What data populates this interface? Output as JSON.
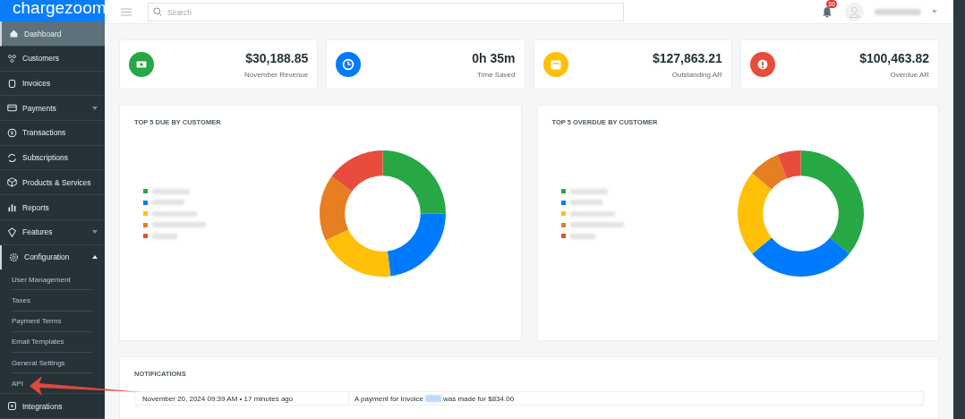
{
  "brand": "chargezoom",
  "sidebar": {
    "items": [
      {
        "label": "Dashboard",
        "selected": true
      },
      {
        "label": "Customers",
        "selected": false
      },
      {
        "label": "Invoices",
        "selected": false
      },
      {
        "label": "Payments",
        "selected": false,
        "expanded": false
      },
      {
        "label": "Transactions",
        "selected": false
      },
      {
        "label": "Subscriptions",
        "selected": false
      },
      {
        "label": "Products & Services",
        "selected": false
      },
      {
        "label": "Reports",
        "selected": false
      },
      {
        "label": "Features",
        "selected": false,
        "expanded": false
      },
      {
        "label": "Configuration",
        "selected": false,
        "expanded": true,
        "children": [
          {
            "label": "User Management",
            "selected": false
          },
          {
            "label": "Taxes",
            "selected": false
          },
          {
            "label": "Payment Terms",
            "selected": false
          },
          {
            "label": "Email Templates",
            "selected": false
          },
          {
            "label": "General Settings",
            "selected": false
          },
          {
            "label": "API",
            "selected": false
          }
        ]
      },
      {
        "label": "Integrations",
        "selected": false
      }
    ]
  },
  "topbar": {
    "search": {
      "placeholder": "Search"
    },
    "notification_badge": "36"
  },
  "stats": [
    {
      "value": "$30,188.85",
      "label": "November Revenue",
      "color": "#28a745"
    },
    {
      "value": "0h 35m",
      "label": "Time Saved",
      "color": "#007bff"
    },
    {
      "value": "$127,863.21",
      "label": "Outstanding AR",
      "color": "#ffc107"
    },
    {
      "value": "$100,463.82",
      "label": "Overdue AR",
      "color": "#e74c3c"
    }
  ],
  "charts": [
    {
      "title": "TOP 5 DUE BY CUSTOMER",
      "legend": [
        {
          "color": "#28a745"
        },
        {
          "color": "#007bff"
        },
        {
          "color": "#ffc107"
        },
        {
          "color": "#e67e22"
        },
        {
          "color": "#e74c3c"
        }
      ]
    },
    {
      "title": "TOP 5 OVERDUE BY CUSTOMER",
      "legend": [
        {
          "color": "#28a745"
        },
        {
          "color": "#007bff"
        },
        {
          "color": "#ffc107"
        },
        {
          "color": "#e67e22"
        },
        {
          "color": "#e74c3c"
        }
      ]
    }
  ],
  "notifications": {
    "title": "NOTIFICATIONS",
    "rows": [
      {
        "time": "November 20, 2024 09:39 AM • 17 minutes ago",
        "message_start": "A payment for Invoice",
        "message_end": "was made for $834.00"
      }
    ]
  }
}
